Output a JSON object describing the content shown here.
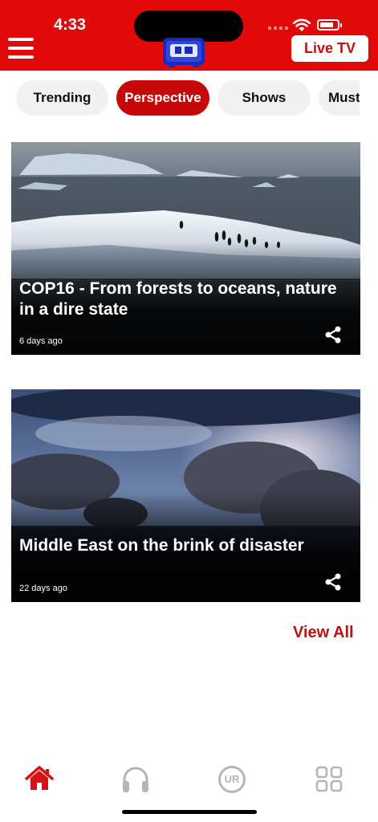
{
  "status": {
    "time": "4:33",
    "battery_level": 0.8
  },
  "header": {
    "live_label": "Live TV"
  },
  "tabs": [
    {
      "label": "Trending",
      "active": false
    },
    {
      "label": "Perspective",
      "active": true
    },
    {
      "label": "Shows",
      "active": false
    },
    {
      "label": "Must",
      "active": false
    }
  ],
  "cards": [
    {
      "title": "COP16 - From forests to oceans, nature in a dire state",
      "age": "6 days ago"
    },
    {
      "title": "Middle East on the brink of disaster",
      "age": "22 days ago"
    }
  ],
  "view_all_label": "View All",
  "bottom_nav": [
    {
      "name": "home-icon",
      "active": true,
      "color": "#d41414"
    },
    {
      "name": "headphones-icon",
      "active": false,
      "color": "#b5b5b5"
    },
    {
      "name": "urdu-icon",
      "label": "UR",
      "active": false,
      "color": "#b5b5b5"
    },
    {
      "name": "grid-icon",
      "active": false,
      "color": "#b5b5b5"
    }
  ],
  "colors": {
    "brand_red": "#e10909",
    "accent": "#c8070a"
  }
}
